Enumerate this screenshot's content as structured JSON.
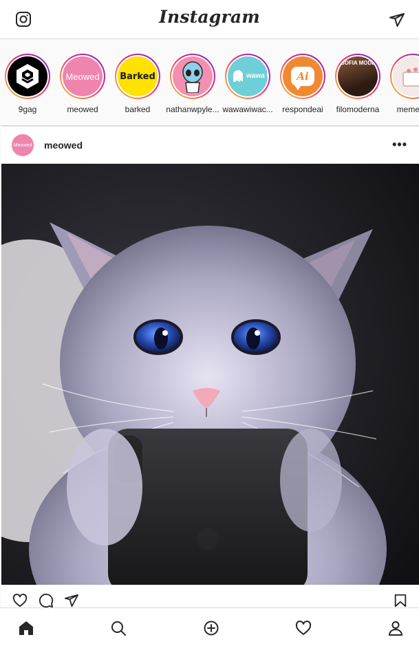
{
  "header": {
    "logo_text": "Instagram",
    "left_icon": "instagram-camera-icon",
    "right_icon": "direct-message-icon"
  },
  "stories": [
    {
      "name": "9gag",
      "avatar_text": ""
    },
    {
      "name": "meowed",
      "avatar_text": "Meowed"
    },
    {
      "name": "barked",
      "avatar_text": "Barked"
    },
    {
      "name": "nathanwpyle...",
      "avatar_text": ""
    },
    {
      "name": "wawawiwac...",
      "avatar_text": "wawa wiwa"
    },
    {
      "name": "respondeai",
      "avatar_text": "Ai"
    },
    {
      "name": "filomoderna",
      "avatar_text": "FILOSOFIA MODERNA"
    },
    {
      "name": "memeria",
      "avatar_text": ""
    }
  ],
  "post": {
    "username": "meowed",
    "avatar_text": "Meowed",
    "more_label": "•••",
    "image_description_icon": "cat-photo"
  },
  "actions": {
    "icons": [
      "heart-icon",
      "comment-icon",
      "share-icon",
      "bookmark-icon"
    ]
  },
  "bottom_nav": {
    "icons": [
      "home-icon",
      "search-icon",
      "add-post-icon",
      "activity-heart-icon",
      "profile-icon"
    ]
  },
  "colors": {
    "story_gradient_start": "#f9ce34",
    "story_gradient_mid": "#ee2a7b",
    "story_gradient_end": "#6228d7",
    "border": "#dbdbdb",
    "text": "#262626"
  }
}
